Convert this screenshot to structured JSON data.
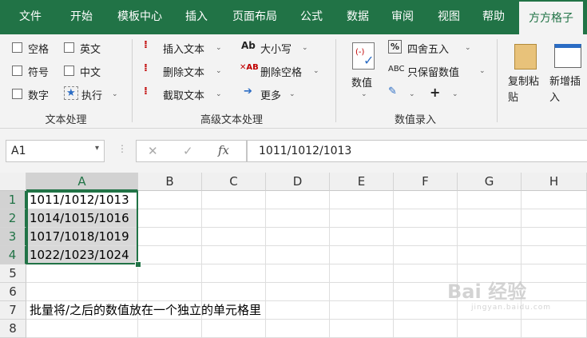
{
  "ribbon_tabs": [
    "文件",
    "开始",
    "模板中心",
    "插入",
    "页面布局",
    "公式",
    "数据",
    "审阅",
    "视图",
    "帮助",
    "方方格子"
  ],
  "active_tab": "方方格子",
  "groups": {
    "text_processing": {
      "label": "文本处理",
      "checks": [
        "空格",
        "英文",
        "符号",
        "中文",
        "数字"
      ],
      "execute": "执行"
    },
    "advanced_text": {
      "label": "高级文本处理",
      "buttons": [
        "插入文本",
        "删除文本",
        "截取文本",
        "大小写",
        "删除空格",
        "更多"
      ]
    },
    "number_entry": {
      "label": "数值录入",
      "value_button": "数值",
      "round_button": "四舍五入",
      "keep_button": "只保留数值",
      "plus": "+"
    },
    "clipboard": {
      "copy_paste": "复制粘贴",
      "add_insert": "新增插入"
    }
  },
  "name_box": "A1",
  "formula_icons": [
    "✕",
    "✓",
    "fx"
  ],
  "formula_value": "1011/1012/1013",
  "columns": [
    "A",
    "B",
    "C",
    "D",
    "E",
    "F",
    "G",
    "H"
  ],
  "rows": [
    "1",
    "2",
    "3",
    "4",
    "5",
    "6",
    "7",
    "8"
  ],
  "cells": {
    "A1": "1011/1012/1013",
    "A2": "1014/1015/1016",
    "A3": "1017/1018/1019",
    "A4": "1022/1023/1024",
    "A7": "批量将/之后的数值放在一个独立的单元格里"
  },
  "watermark": {
    "main": "Bai 经验",
    "sub": "jingyan.baidu.com"
  }
}
